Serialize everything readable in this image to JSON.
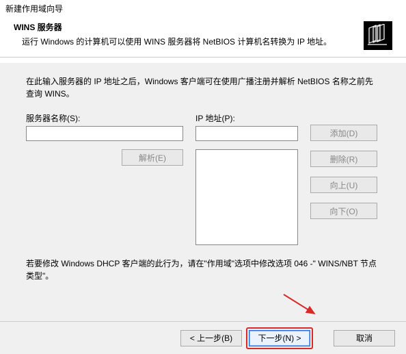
{
  "window": {
    "title": "新建作用域向导"
  },
  "header": {
    "title": "WINS 服务器",
    "description": "运行 Windows 的计算机可以使用 WINS 服务器将 NetBIOS 计算机名转换为 IP 地址。"
  },
  "body": {
    "intro": "在此输入服务器的 IP 地址之后，Windows 客户端可在使用广播注册并解析 NetBIOS 名称之前先查询 WINS。",
    "server_name_label": "服务器名称(S):",
    "server_name_value": "",
    "ip_label": "IP 地址(P):",
    "ip_value": "",
    "resolve_label": "解析(E)",
    "add_label": "添加(D)",
    "remove_label": "删除(R)",
    "up_label": "向上(U)",
    "down_label": "向下(O)",
    "note": "若要修改 Windows DHCP 客户端的此行为，请在\"作用域\"选项中修改选项 046 -\" WINS/NBT 节点类型\"。"
  },
  "footer": {
    "back": "< 上一步(B)",
    "next": "下一步(N) >",
    "cancel": "取消"
  }
}
